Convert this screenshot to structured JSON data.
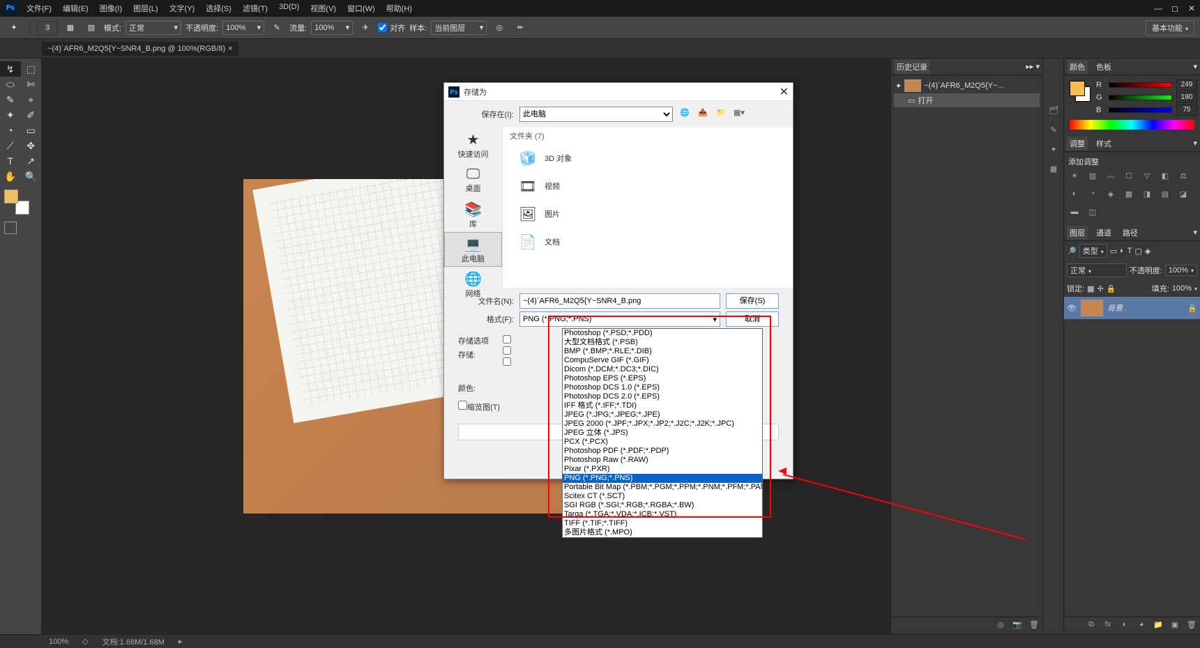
{
  "titlebar": {
    "logo": "Ps",
    "menus": [
      "文件(F)",
      "编辑(E)",
      "图像(I)",
      "图层(L)",
      "文字(Y)",
      "选择(S)",
      "滤镜(T)",
      "3D(D)",
      "视图(V)",
      "窗口(W)",
      "帮助(H)"
    ]
  },
  "options": {
    "brush_size": "3",
    "mode_label": "模式:",
    "mode_value": "正常",
    "opacity_label": "不透明度:",
    "opacity_value": "100%",
    "flow_label": "流量:",
    "flow_value": "100%",
    "align_label": "对齐",
    "sample_label": "样本:",
    "sample_value": "当前图层",
    "workspace": "基本功能"
  },
  "tab": {
    "title": "~(4)`AFR6_M2Q5{Y~SNR4_B.png @ 100%(RGB/8)",
    "close": "×"
  },
  "toolbox_icons": [
    "↯",
    "⬚",
    "⬭",
    "✄",
    "✎",
    "⌖",
    "✦",
    "✐",
    "◔",
    "▭",
    "⟋",
    "✥",
    "T",
    "↗",
    "✋",
    "🔍"
  ],
  "history": {
    "title": "历史记录",
    "item": "~(4)`AFR6_M2Q5{Y~...",
    "item2": "打开"
  },
  "color": {
    "tab1": "颜色",
    "tab2": "色板",
    "r_label": "R",
    "r_value": "249",
    "g_label": "G",
    "g_value": "190",
    "b_label": "B",
    "b_value": "75"
  },
  "adjust": {
    "tab1": "调整",
    "tab2": "样式",
    "label": "添加调整"
  },
  "layers": {
    "tab1": "图层",
    "tab2": "通道",
    "tab3": "路径",
    "kind_icon": "🔎",
    "kind": "类型",
    "blend": "正常",
    "opacity_label": "不透明度:",
    "opacity_value": "100%",
    "lock_label": "锁定:",
    "fill_label": "填充:",
    "fill_value": "100%",
    "layer_name": "背景"
  },
  "status": {
    "zoom": "100%",
    "doc": "文档:1.68M/1.68M"
  },
  "dialog": {
    "title": "存储为",
    "save_in_label": "保存在(I):",
    "save_in_value": "此电脑",
    "sidebar": [
      {
        "icon": "★",
        "label": "快速访问"
      },
      {
        "icon": "🖵",
        "label": "桌面"
      },
      {
        "icon": "📚",
        "label": "库"
      },
      {
        "icon": "💻",
        "label": "此电脑"
      },
      {
        "icon": "🌐",
        "label": "网络"
      }
    ],
    "folder_header": "文件夹 (7)",
    "files": [
      {
        "icon": "🧊",
        "label": "3D 对象"
      },
      {
        "icon": "🎞",
        "label": "视频"
      },
      {
        "icon": "🖼",
        "label": "图片"
      },
      {
        "icon": "📄",
        "label": "文档"
      }
    ],
    "filename_label": "文件名(N):",
    "filename_value": "~(4)`AFR6_M2Q5{Y~SNR4_B.png",
    "format_label": "格式(F):",
    "format_value": "PNG (*.PNG;*.PNS)",
    "save_btn": "保存(S)",
    "cancel_btn": "取消",
    "opt_title": "存储选项",
    "opt_label": "存储:",
    "color_label": "颜色:",
    "thumb_label": "缩览图(T)"
  },
  "formats": [
    "Photoshop (*.PSD;*.PDD)",
    "大型文档格式 (*.PSB)",
    "BMP (*.BMP;*.RLE;*.DIB)",
    "CompuServe GIF (*.GIF)",
    "Dicom (*.DCM;*.DC3;*.DIC)",
    "Photoshop EPS (*.EPS)",
    "Photoshop DCS 1.0 (*.EPS)",
    "Photoshop DCS 2.0 (*.EPS)",
    "IFF 格式 (*.IFF;*.TDI)",
    "JPEG (*.JPG;*.JPEG;*.JPE)",
    "JPEG 2000 (*.JPF;*.JPX;*.JP2;*.J2C;*.J2K;*.JPC)",
    "JPEG 立体 (*.JPS)",
    "PCX (*.PCX)",
    "Photoshop PDF (*.PDF;*.PDP)",
    "Photoshop Raw (*.RAW)",
    "Pixar (*.PXR)",
    "PNG (*.PNG;*.PNS)",
    "Portable Bit Map (*.PBM;*.PGM;*.PPM;*.PNM;*.PFM;*.PAM)",
    "Scitex CT (*.SCT)",
    "SGI RGB (*.SGI;*.RGB;*.RGBA;*.BW)",
    "Targa (*.TGA;*.VDA;*.ICB;*.VST)",
    "TIFF (*.TIF;*.TIFF)",
    "多图片格式 (*.MPO)"
  ],
  "format_selected_index": 16
}
